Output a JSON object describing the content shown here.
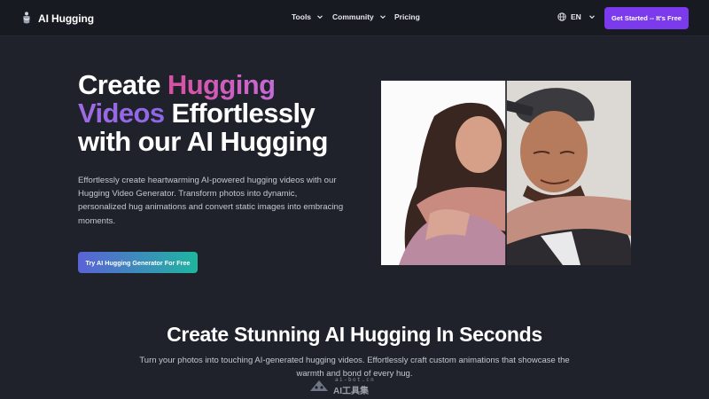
{
  "header": {
    "brand": "AI Hugging",
    "nav": [
      {
        "label": "Tools",
        "has_dropdown": true
      },
      {
        "label": "Community",
        "has_dropdown": true
      },
      {
        "label": "Pricing",
        "has_dropdown": false
      }
    ],
    "language": "EN",
    "cta_label": "Get Started -- It's Free"
  },
  "hero": {
    "title_word1": "Create",
    "title_highlight1": "Hugging",
    "title_highlight2": "Videos",
    "title_rest1": "Effortlessly",
    "title_line3": "with our AI Hugging",
    "description": "Effortlessly create heartwarming AI-powered hugging videos with our Hugging Video Generator. Transform photos into dynamic, personalized hug animations and convert static images into embracing moments.",
    "button_label": "Try AI Hugging Generator For Free",
    "image_icon": "hug-photo-comparison"
  },
  "section": {
    "title": "Create Stunning AI Hugging In Seconds",
    "description": "Turn your photos into touching AI-generated hugging videos. Effortlessly craft custom animations that showcase the warmth and bond of every hug."
  },
  "watermark": {
    "url": "ai-bot.cn",
    "text": "AI工具集"
  },
  "colors": {
    "background": "#1f222b",
    "navbar": "#181a21",
    "accent_purple": "#7c3aed",
    "gradient_pink": "#d94fa0",
    "gradient_violet": "#a06ae4",
    "button_gradient_start": "#5b62d6",
    "button_gradient_end": "#1fb5a0"
  }
}
